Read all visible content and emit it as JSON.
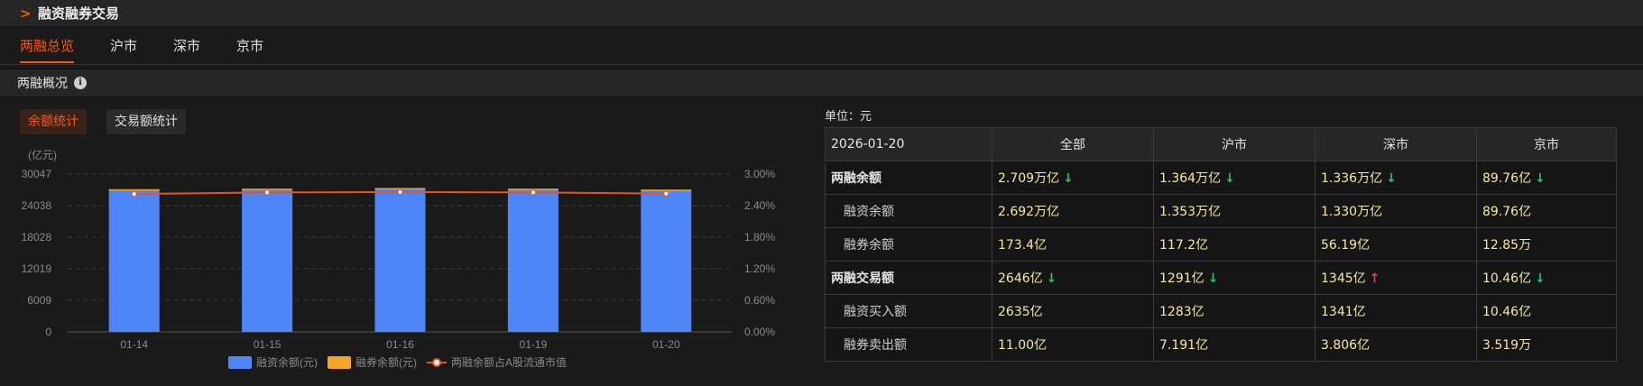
{
  "header": {
    "title": "融资融券交易"
  },
  "tabs": [
    "两融总览",
    "沪市",
    "深市",
    "京市"
  ],
  "section": {
    "title": "两融概况"
  },
  "toggle": {
    "balance": "余额统计",
    "volume": "交易额统计"
  },
  "colors": {
    "accent": "#f25a1d",
    "financing": "#4f86f7",
    "securities_lending": "#f4a524",
    "ratio_line": "#e8541a",
    "value_text": "#f4e9a6",
    "down": "#27c26a",
    "up": "#ff3b3b"
  },
  "chart_data": {
    "type": "bar",
    "unit_label": "(亿元)",
    "categories": [
      "01-14",
      "01-15",
      "01-16",
      "01-19",
      "01-20"
    ],
    "series": [
      {
        "name": "融资余额(元)",
        "type": "bar",
        "values": [
          26985,
          27091,
          27213,
          27095,
          26920
        ]
      },
      {
        "name": "融券余额(元)",
        "type": "bar",
        "values": [
          175,
          176,
          177,
          175,
          173
        ]
      },
      {
        "name": "两融余额占A股流通市值",
        "type": "line",
        "axis": "right",
        "values": [
          2.62,
          2.65,
          2.66,
          2.65,
          2.63
        ]
      }
    ],
    "y_left": {
      "min": 0,
      "max": 30047,
      "ticks": [
        "0",
        "6009",
        "12019",
        "18028",
        "24038",
        "30047"
      ]
    },
    "y_right": {
      "min": 0,
      "max": 3.0,
      "ticks": [
        "0.00%",
        "0.60%",
        "1.20%",
        "1.80%",
        "2.40%",
        "3.00%"
      ]
    },
    "grid": true,
    "legend_position": "bottom"
  },
  "table": {
    "unit": "单位：元",
    "date": "2026-01-20",
    "columns": [
      "全部",
      "沪市",
      "深市",
      "京市"
    ],
    "rows": [
      {
        "label": "两融余额",
        "level": "main",
        "cells": [
          {
            "v": "2.709万亿",
            "t": "down"
          },
          {
            "v": "1.364万亿",
            "t": "down"
          },
          {
            "v": "1.336万亿",
            "t": "down"
          },
          {
            "v": "89.76亿",
            "t": "down"
          }
        ]
      },
      {
        "label": "融资余额",
        "level": "sub",
        "cells": [
          {
            "v": "2.692万亿"
          },
          {
            "v": "1.353万亿"
          },
          {
            "v": "1.330万亿"
          },
          {
            "v": "89.76亿"
          }
        ]
      },
      {
        "label": "融券余额",
        "level": "sub",
        "cells": [
          {
            "v": "173.4亿"
          },
          {
            "v": "117.2亿"
          },
          {
            "v": "56.19亿"
          },
          {
            "v": "12.85万"
          }
        ]
      },
      {
        "label": "两融交易额",
        "level": "main",
        "cells": [
          {
            "v": "2646亿",
            "t": "down"
          },
          {
            "v": "1291亿",
            "t": "down"
          },
          {
            "v": "1345亿",
            "t": "up"
          },
          {
            "v": "10.46亿",
            "t": "down"
          }
        ]
      },
      {
        "label": "融资买入额",
        "level": "sub",
        "cells": [
          {
            "v": "2635亿"
          },
          {
            "v": "1283亿"
          },
          {
            "v": "1341亿"
          },
          {
            "v": "10.46亿"
          }
        ]
      },
      {
        "label": "融券卖出额",
        "level": "sub",
        "cells": [
          {
            "v": "11.00亿"
          },
          {
            "v": "7.191亿"
          },
          {
            "v": "3.806亿"
          },
          {
            "v": "3.519万"
          }
        ]
      }
    ]
  }
}
